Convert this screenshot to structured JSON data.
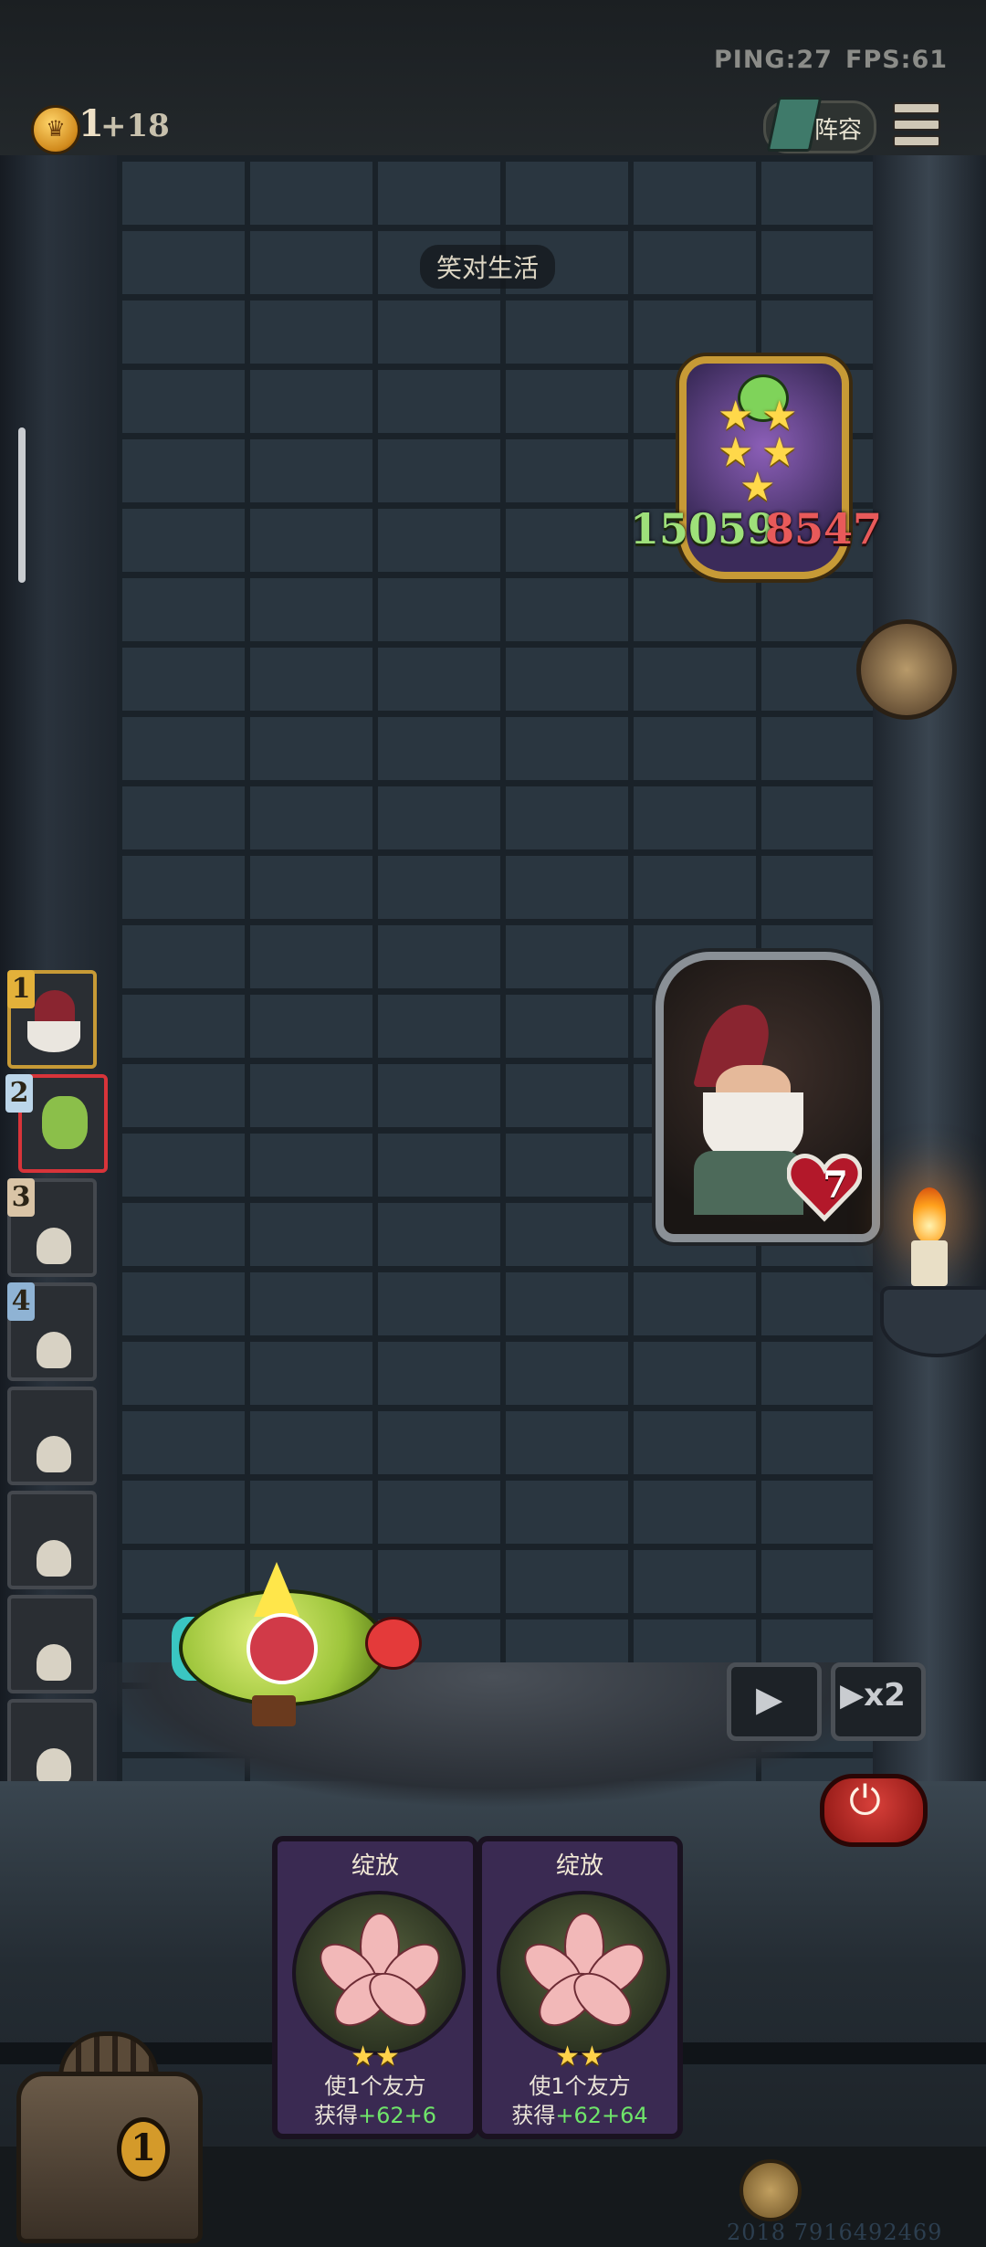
{
  "hud": {
    "ping": "PING:27",
    "fps": "FPS:61",
    "coins": "1",
    "coin_bonus": "+18",
    "lineup_label": "阵容"
  },
  "level": {
    "name": "笑对生活"
  },
  "boss": {
    "attack": "15059",
    "health": "8547",
    "stars": 5
  },
  "enemy": {
    "health": "7"
  },
  "roster": {
    "slots": [
      {
        "number": "1",
        "state": "hero"
      },
      {
        "number": "2",
        "state": "hero-selected"
      },
      {
        "number": "3",
        "state": "dead"
      },
      {
        "number": "4",
        "state": "dead"
      },
      {
        "number": "",
        "state": "dead"
      },
      {
        "number": "",
        "state": "dead"
      },
      {
        "number": "",
        "state": "dead"
      },
      {
        "number": "",
        "state": "dead"
      }
    ]
  },
  "controls": {
    "speed_label": "▶x2",
    "play_icon": "play-icon",
    "power_icon": "power-icon"
  },
  "cards": [
    {
      "title": "绽放",
      "stars": "★★",
      "line1": "使1个友方",
      "line2_prefix": "获得",
      "atk": "+62",
      "hp": "+6"
    },
    {
      "title": "绽放",
      "stars": "★★",
      "line1": "使1个友方",
      "line2_prefix": "获得",
      "atk": "+62",
      "hp": "+64"
    }
  ],
  "chest": {
    "count": "1"
  },
  "player_id": "2018 7916492469",
  "colors": {
    "accent_gold": "#c79a36",
    "hp_red": "#e85a5a",
    "atk_green": "#9ee07a",
    "card_purple": "#3a2a52"
  }
}
